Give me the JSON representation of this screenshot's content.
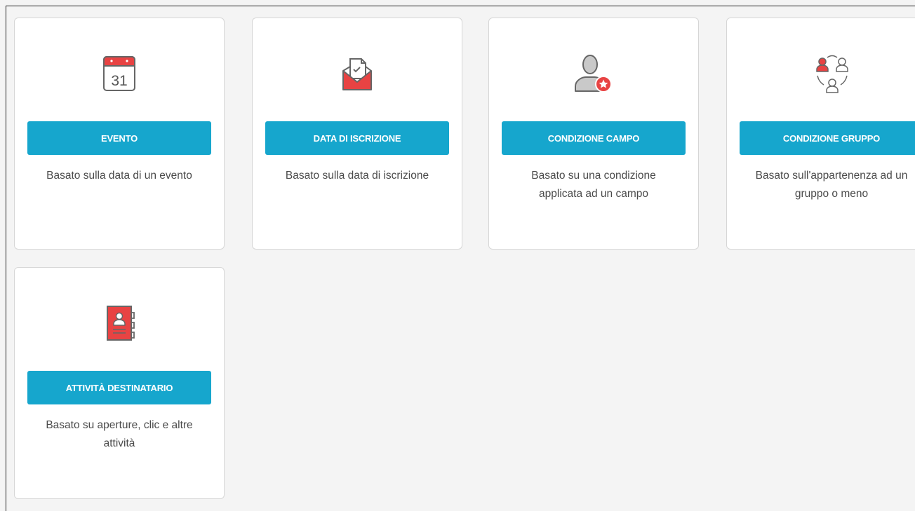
{
  "colors": {
    "accent": "#16a6cd",
    "icon_red": "#e84343",
    "icon_gray": "#bdbdbd"
  },
  "cards": [
    {
      "icon": "calendar-icon",
      "calendar_day": "31",
      "button": "EVENTO",
      "description": "Basato sulla data di un evento"
    },
    {
      "icon": "envelope-check-icon",
      "button": "DATA DI ISCRIZIONE",
      "description": "Basato sulla data di iscrizione"
    },
    {
      "icon": "user-badge-icon",
      "button": "CONDIZIONE CAMPO",
      "description": "Basato su una condizione\napplicata ad un campo"
    },
    {
      "icon": "user-group-icon",
      "button": "CONDIZIONE GRUPPO",
      "description": "Basato sull'appartenenza ad un\ngruppo o meno"
    },
    {
      "icon": "contact-book-icon",
      "button": "ATTIVITÀ DESTINATARIO",
      "description": "Basato su aperture, clic e altre\nattività"
    }
  ]
}
